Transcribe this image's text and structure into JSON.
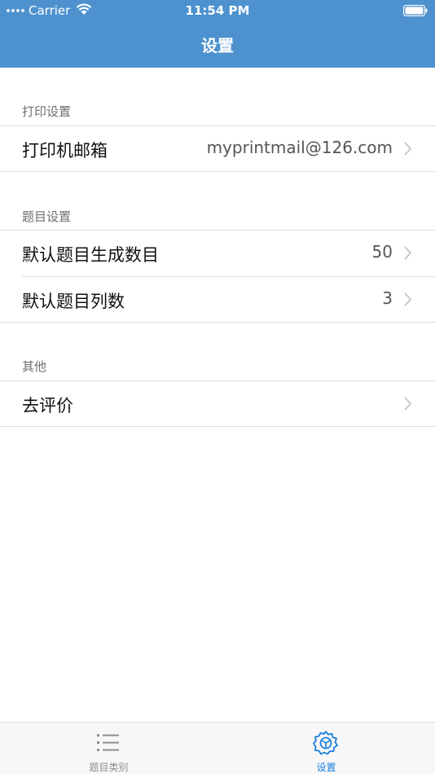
{
  "status_bar": {
    "carrier": "Carrier",
    "time": "11:54 PM"
  },
  "nav": {
    "title": "设置"
  },
  "sections": [
    {
      "header": "打印设置",
      "rows": [
        {
          "label": "打印机邮箱",
          "value": "myprintmail@126.com"
        }
      ]
    },
    {
      "header": "题目设置",
      "rows": [
        {
          "label": "默认题目生成数目",
          "value": "50"
        },
        {
          "label": "默认题目列数",
          "value": "3"
        }
      ]
    },
    {
      "header": "其他",
      "rows": [
        {
          "label": "去评价",
          "value": ""
        }
      ]
    }
  ],
  "tabs": [
    {
      "label": "题目类别",
      "icon": "list-icon",
      "active": false
    },
    {
      "label": "设置",
      "icon": "gear-icon",
      "active": true
    }
  ],
  "colors": {
    "nav_bg": "#4d92cf",
    "tab_active": "#1a7fe0",
    "tab_inactive": "#8e8e93"
  }
}
